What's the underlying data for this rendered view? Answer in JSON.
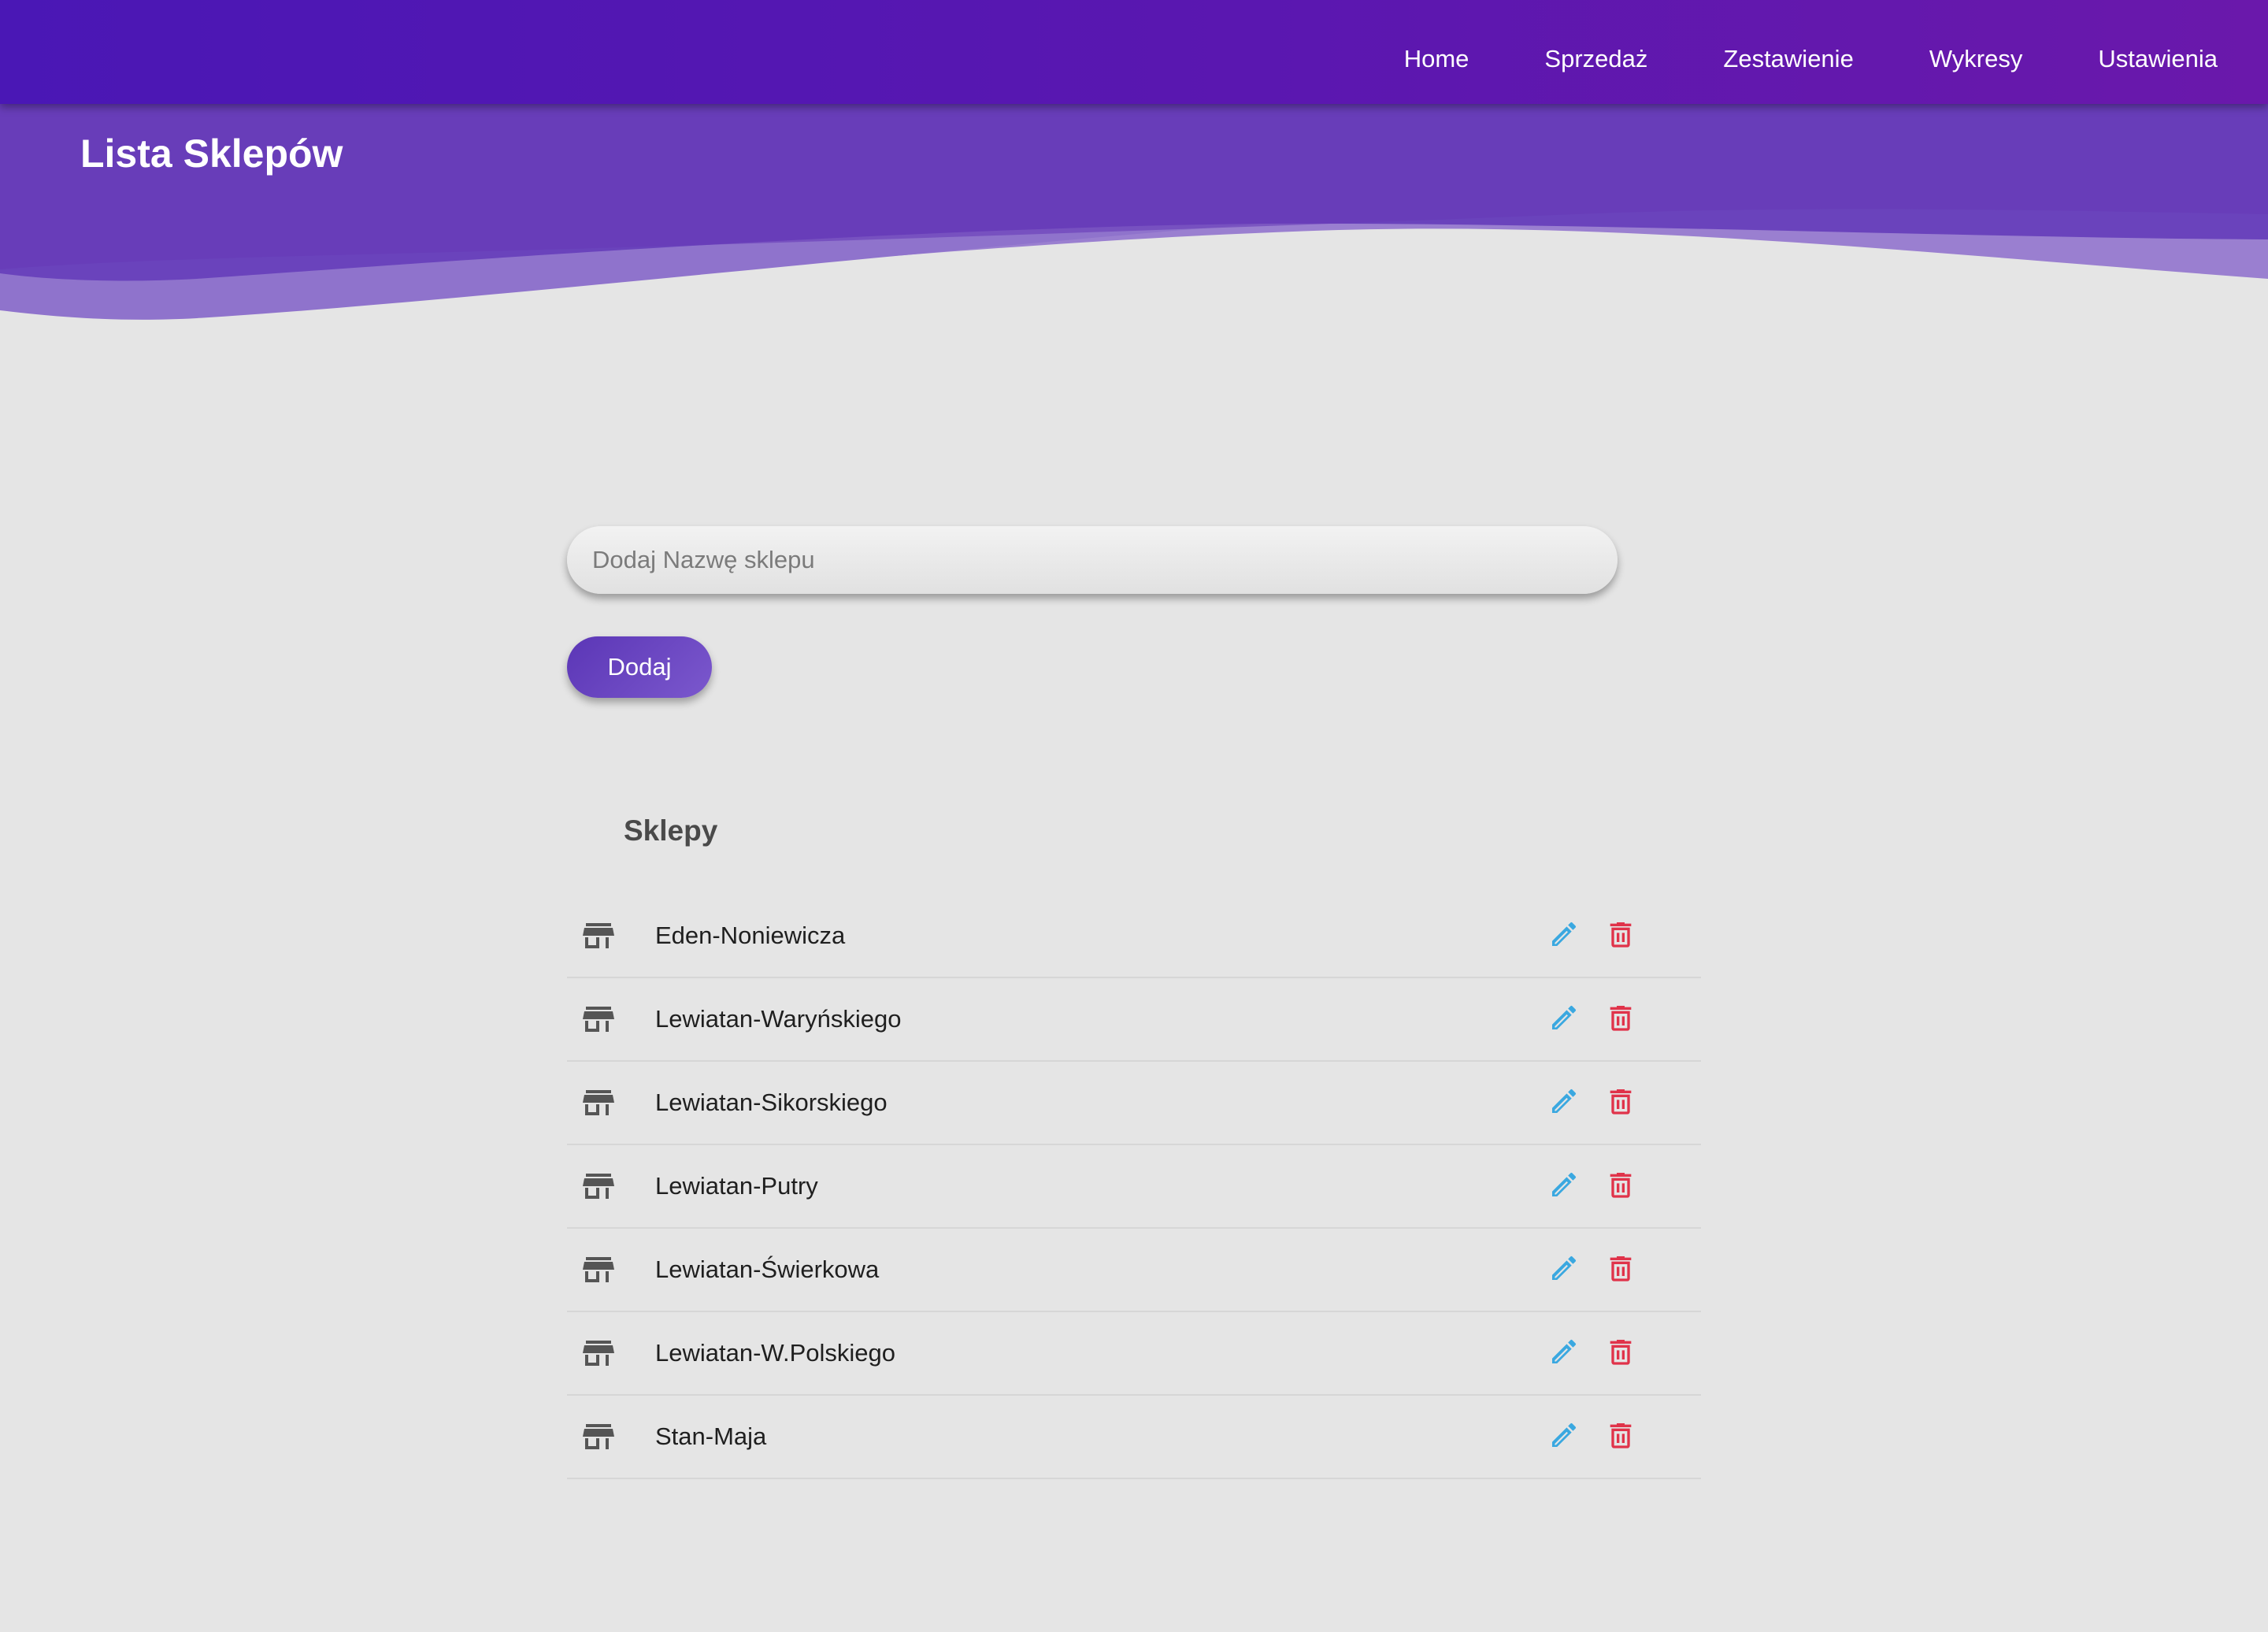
{
  "nav": {
    "items": [
      {
        "label": "Home"
      },
      {
        "label": "Sprzedaż"
      },
      {
        "label": "Zestawienie"
      },
      {
        "label": "Wykresy"
      },
      {
        "label": "Ustawienia"
      }
    ]
  },
  "page": {
    "title": "Lista Sklepów"
  },
  "form": {
    "input_value": "",
    "input_placeholder": "Dodaj Nazwę sklepu",
    "add_label": "Dodaj"
  },
  "list": {
    "title": "Sklepy",
    "shops": [
      {
        "name": "Eden-Noniewicza"
      },
      {
        "name": "Lewiatan-Waryńskiego"
      },
      {
        "name": "Lewiatan-Sikorskiego"
      },
      {
        "name": "Lewiatan-Putry"
      },
      {
        "name": "Lewiatan-Świerkowa"
      },
      {
        "name": "Lewiatan-W.Polskiego"
      },
      {
        "name": "Stan-Maja"
      }
    ]
  },
  "icons": {
    "shop": "store-icon",
    "edit": "pencil-icon",
    "delete": "trash-icon"
  },
  "colors": {
    "nav_gradient_start": "#4a17b5",
    "nav_gradient_end": "#6a18ab",
    "hero": "#673ab7",
    "accent_button": "#5b36b6",
    "edit_icon": "#3aa8e0",
    "delete_icon": "#e0334a",
    "background": "#e5e5e5"
  }
}
